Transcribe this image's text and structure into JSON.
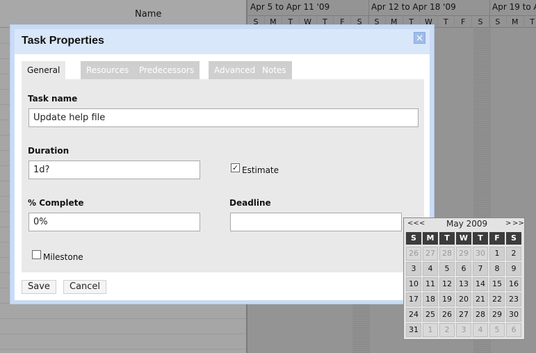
{
  "background": {
    "name_header": "Name",
    "weeks": [
      "Apr 5 to Apr 11 '09",
      "Apr 12 to Apr 18 '09",
      "Apr 19 to Ap"
    ],
    "day_letters": [
      "S",
      "M",
      "T",
      "W",
      "T",
      "F",
      "S",
      "S",
      "M",
      "T",
      "W",
      "T",
      "F",
      "S",
      "S",
      "M",
      "T"
    ]
  },
  "dialog": {
    "title": "Task Properties",
    "close_symbol": "×",
    "tabs": [
      {
        "label": "General",
        "active": true
      },
      {
        "label": "Resources",
        "active": false
      },
      {
        "label": "Predecessors",
        "active": false
      },
      {
        "label": "Advanced",
        "active": false
      },
      {
        "label": "Notes",
        "active": false
      }
    ],
    "task_name": {
      "label": "Task name",
      "value": "Update help file"
    },
    "duration": {
      "label": "Duration",
      "value": "1d?"
    },
    "estimate": {
      "label": "Estimate",
      "checked": true,
      "check_mark": "✓"
    },
    "percent_complete": {
      "label": "% Complete",
      "value": "0%"
    },
    "deadline": {
      "label": "Deadline",
      "value": ""
    },
    "milestone": {
      "label": "Milestone",
      "checked": false
    },
    "save_label": "Save",
    "cancel_label": "Cancel"
  },
  "calendar": {
    "prev_year": "<<",
    "prev_month": "<",
    "title": "May 2009",
    "next_month": ">",
    "next_year": ">>",
    "weekdays": [
      "S",
      "M",
      "T",
      "W",
      "T",
      "F",
      "S"
    ],
    "weeks": [
      [
        {
          "d": "26",
          "other": true
        },
        {
          "d": "27",
          "other": true
        },
        {
          "d": "28",
          "other": true
        },
        {
          "d": "29",
          "other": true
        },
        {
          "d": "30",
          "other": true
        },
        {
          "d": "1"
        },
        {
          "d": "2"
        }
      ],
      [
        {
          "d": "3"
        },
        {
          "d": "4"
        },
        {
          "d": "5"
        },
        {
          "d": "6"
        },
        {
          "d": "7"
        },
        {
          "d": "8"
        },
        {
          "d": "9"
        }
      ],
      [
        {
          "d": "10"
        },
        {
          "d": "11"
        },
        {
          "d": "12"
        },
        {
          "d": "13"
        },
        {
          "d": "14"
        },
        {
          "d": "15"
        },
        {
          "d": "16"
        }
      ],
      [
        {
          "d": "17"
        },
        {
          "d": "18"
        },
        {
          "d": "19"
        },
        {
          "d": "20"
        },
        {
          "d": "21"
        },
        {
          "d": "22"
        },
        {
          "d": "23"
        }
      ],
      [
        {
          "d": "24"
        },
        {
          "d": "25"
        },
        {
          "d": "26"
        },
        {
          "d": "27"
        },
        {
          "d": "28"
        },
        {
          "d": "29"
        },
        {
          "d": "30"
        }
      ],
      [
        {
          "d": "31"
        },
        {
          "d": "1",
          "other": true
        },
        {
          "d": "2",
          "other": true
        },
        {
          "d": "3",
          "other": true
        },
        {
          "d": "4",
          "other": true
        },
        {
          "d": "5",
          "other": true
        },
        {
          "d": "6",
          "other": true
        }
      ]
    ]
  }
}
